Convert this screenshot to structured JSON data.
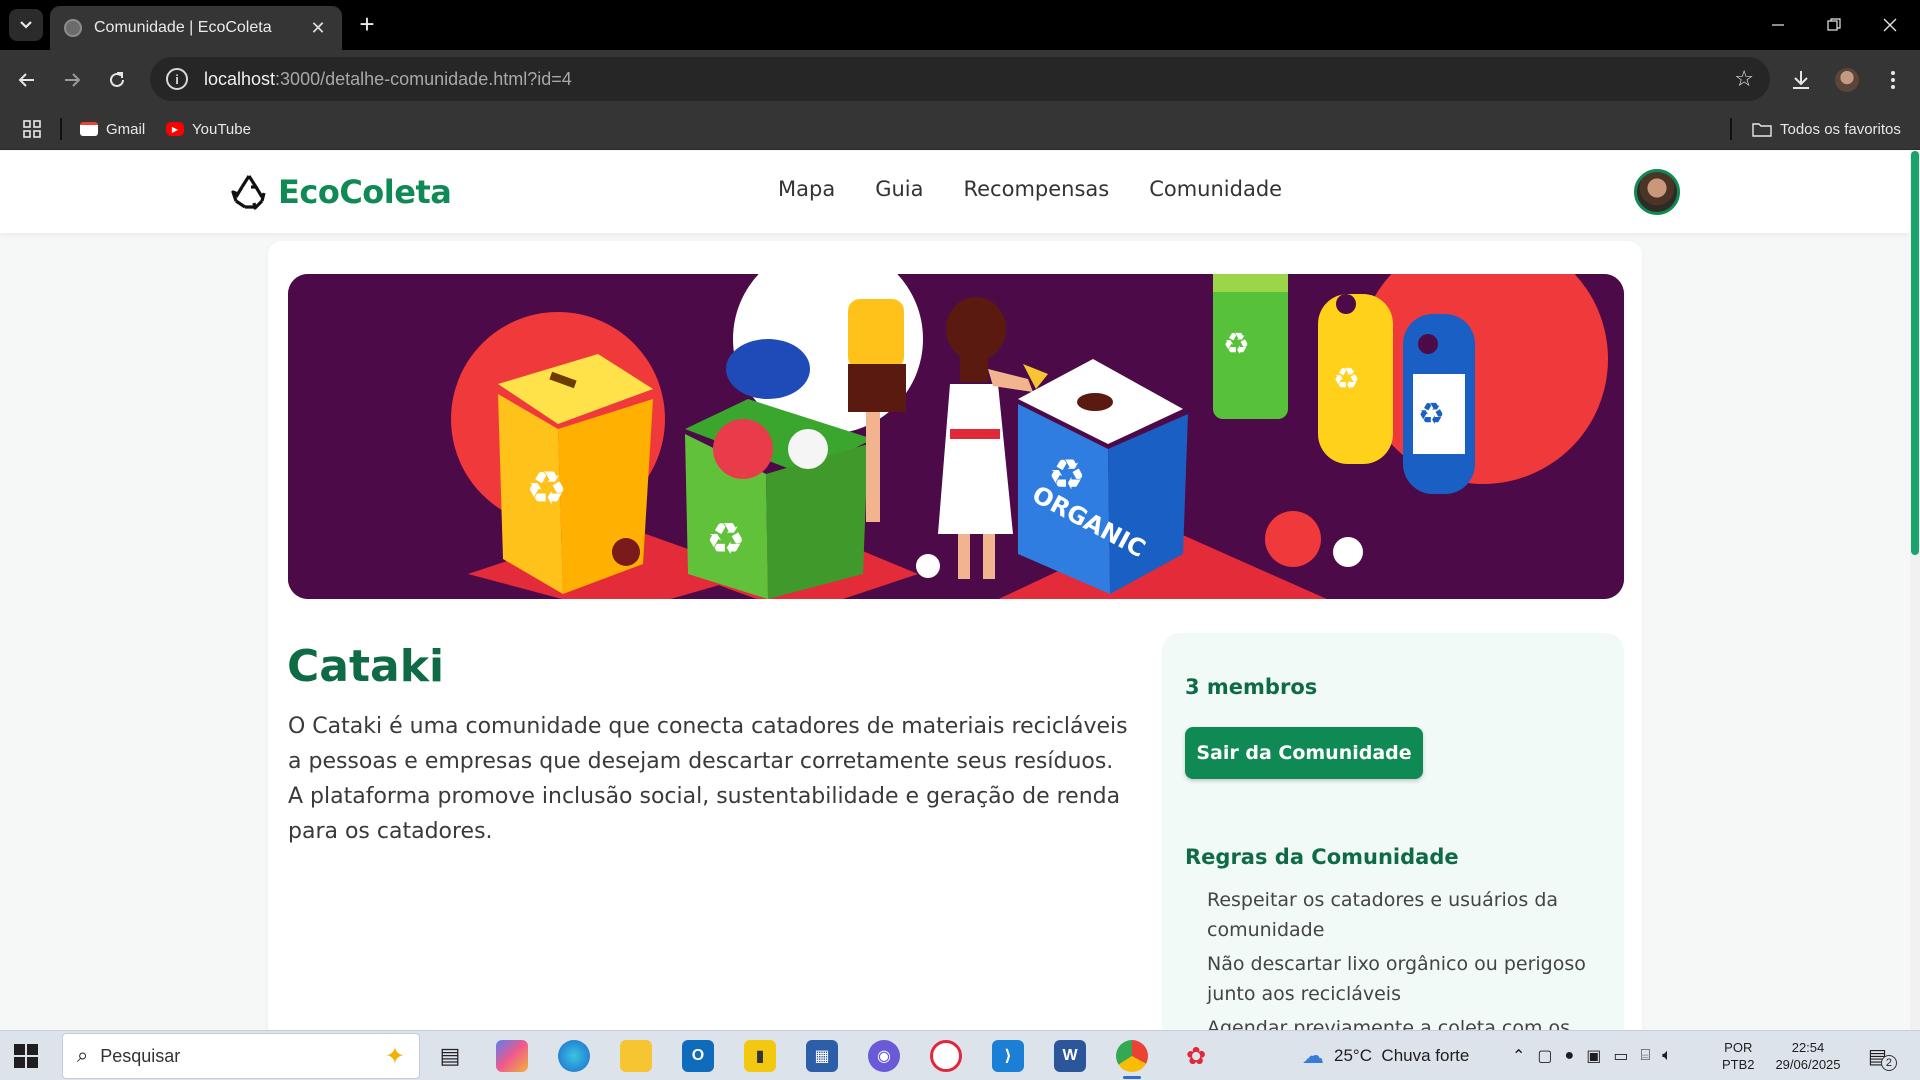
{
  "browser": {
    "tab_title": "Comunidade | EcoColeta",
    "url_host": "localhost",
    "url_rest": ":3000/detalhe-comunidade.html?id=4",
    "bookmarks": [
      "Gmail",
      "YouTube"
    ],
    "all_bookmarks": "Todos os favoritos"
  },
  "site": {
    "brand": "EcoColeta",
    "nav": [
      "Mapa",
      "Guia",
      "Recompensas",
      "Comunidade"
    ],
    "brand_color": "#0f8a55"
  },
  "community": {
    "title": "Cataki",
    "description": "O Cataki é uma comunidade que conecta catadores de materiais recicláveis a pessoas e empresas que desejam descartar corretamente seus resíduos. A plataforma promove inclusão social, sustentabilidade e geração de renda para os catadores.",
    "members": "3 membros",
    "leave_button": "Sair da Comunidade",
    "rules_title": "Regras da Comunidade",
    "rules": [
      "Respeitar os catadores e usuários da comunidade",
      "Não descartar lixo orgânico ou perigoso junto aos recicláveis",
      "Agendar previamente a coleta com os"
    ],
    "banner_text": "ORGANIC"
  },
  "taskbar": {
    "search_placeholder": "Pesquisar",
    "weather": "25°C  Chuva forte",
    "lang_top": "POR",
    "lang_bottom": "PTB2",
    "time": "22:54",
    "date": "29/06/2025",
    "notifications": "2"
  }
}
